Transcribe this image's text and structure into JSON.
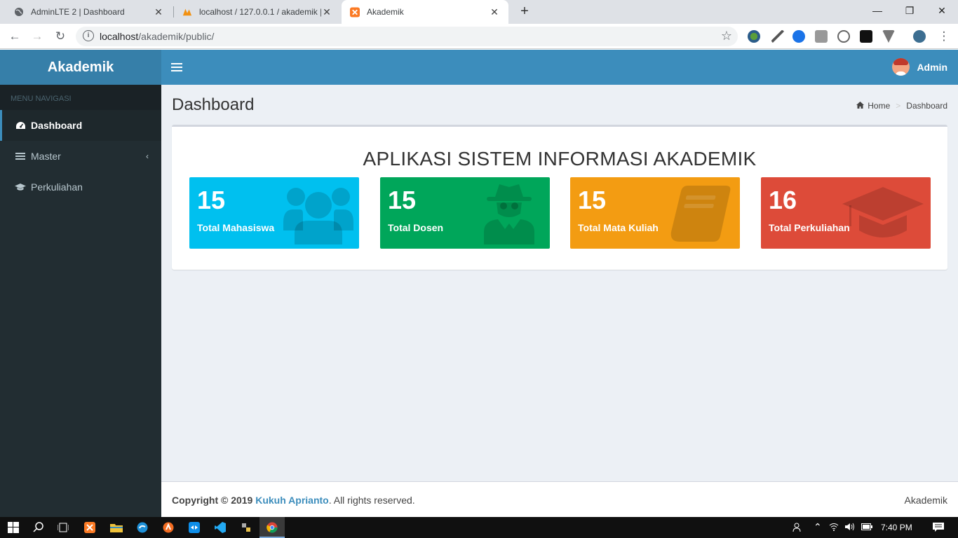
{
  "browser": {
    "tabs": [
      {
        "title": "AdminLTE 2 | Dashboard",
        "icon": "globe-icon"
      },
      {
        "title": "localhost / 127.0.0.1 / akademik |",
        "icon": "phpmyadmin-icon"
      },
      {
        "title": "Akademik",
        "icon": "xampp-icon",
        "active": true
      }
    ],
    "url_host": "localhost",
    "url_path": "/akademik/public/"
  },
  "app": {
    "brand": "Akademik",
    "user_name": "Admin",
    "menu_header": "MENU NAVIGASI",
    "menu": [
      {
        "label": "Dashboard",
        "icon": "dashboard-icon",
        "active": true
      },
      {
        "label": "Master",
        "icon": "bars-icon",
        "has_children": true
      },
      {
        "label": "Perkuliahan",
        "icon": "graduation-cap-icon"
      }
    ],
    "page_title": "Dashboard",
    "breadcrumb": {
      "home": "Home",
      "current": "Dashboard"
    },
    "box_title": "APLIKASI SISTEM INFORMASI AKADEMIK",
    "stats": [
      {
        "value": "15",
        "label": "Total Mahasiswa",
        "color": "#00c0ef",
        "icon": "users-icon"
      },
      {
        "value": "15",
        "label": "Total Dosen",
        "color": "#00a65a",
        "icon": "user-secret-icon"
      },
      {
        "value": "15",
        "label": "Total Mata Kuliah",
        "color": "#f39c12",
        "icon": "book-icon"
      },
      {
        "value": "16",
        "label": "Total Perkuliahan",
        "color": "#dd4b39",
        "icon": "graduation-cap-icon"
      }
    ],
    "footer": {
      "prefix": "Copyright © 2019 ",
      "author": "Kukuh Aprianto",
      "suffix": ". All rights reserved.",
      "right": "Akademik"
    }
  },
  "taskbar": {
    "clock": "7:40 PM"
  }
}
